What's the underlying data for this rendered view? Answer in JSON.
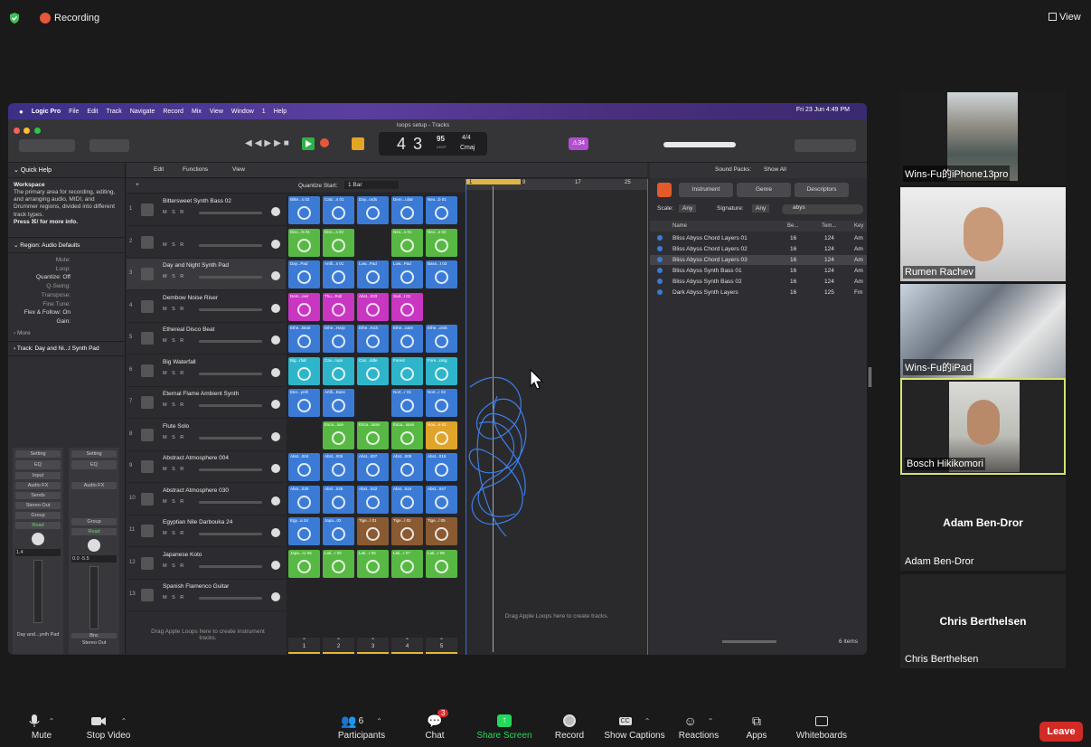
{
  "zoom": {
    "recording_label": "Recording",
    "view_label": "View",
    "toolbar": [
      {
        "label": "Mute",
        "icon": "microphone-icon"
      },
      {
        "label": "Stop Video",
        "icon": "camera-icon"
      },
      {
        "label": "Participants",
        "icon": "participants-icon",
        "count": "6"
      },
      {
        "label": "Chat",
        "icon": "chat-icon",
        "badge": "3"
      },
      {
        "label": "Share Screen",
        "icon": "share-screen-icon"
      },
      {
        "label": "Record",
        "icon": "record-icon"
      },
      {
        "label": "Show Captions",
        "icon": "captions-icon"
      },
      {
        "label": "Reactions",
        "icon": "reactions-icon"
      },
      {
        "label": "Apps",
        "icon": "apps-icon"
      },
      {
        "label": "Whiteboards",
        "icon": "whiteboard-icon"
      }
    ],
    "leave_label": "Leave",
    "participants": [
      {
        "name": "Wins-Fu的iPhone13pro"
      },
      {
        "name": "Rumen Rachev"
      },
      {
        "name": "Wins-Fu的iPad"
      },
      {
        "name": "Bosch Hikikomori"
      },
      {
        "name": "Adam Ben-Dror",
        "big": "Adam Ben-Dror"
      },
      {
        "name": "Chris Berthelsen",
        "big": "Chris Berthelsen"
      }
    ],
    "accent": "#0e72ed",
    "speaker_border": "#d7e46d",
    "share_green": "#23d95c"
  },
  "mac_menu": {
    "app": "Logic Pro",
    "items": [
      "File",
      "Edit",
      "Track",
      "Navigate",
      "Record",
      "Mix",
      "View",
      "Window",
      "1",
      "Help"
    ],
    "clock": "Fri 23 Jun  4:49 PM"
  },
  "logic": {
    "window_title": "loops setup - Tracks",
    "lcd": {
      "bar": "4",
      "beat": "3",
      "tempo": "95",
      "tempo_label": "KEEP",
      "sig": "4/4",
      "key": "Cmaj"
    },
    "badge": "⚠34",
    "quick_help": {
      "title": "Quick Help",
      "heading": "Workspace",
      "body": "The primary area for recording, editing, and arranging audio, MIDI, and Drummer regions, divided into different track types.",
      "more": "Press ⌘/ for more info.",
      "region_title": "Region: Audio Defaults",
      "params": [
        "Mute:",
        "Loop:",
        "Quantize: Off",
        "Q-Swing:",
        "Transpose:",
        "Fine Tune:",
        "Flex & Follow: On",
        "Gain:"
      ],
      "more_label": "More",
      "track_label": "Track:  Day and Ni...t Synth Pad",
      "strip1": {
        "setting": "Setting",
        "eq": "EQ",
        "input": "Input",
        "fx": "Audio FX",
        "sends": "Sends",
        "out": "Stereo Out",
        "group": "Group",
        "read": "Read",
        "vals": "1.4",
        "name": "Day and...ynth Pad"
      },
      "strip2": {
        "setting": "Setting",
        "eq": "EQ",
        "fx": "Audio FX",
        "group": "Group",
        "read": "Read",
        "vals": "0.0  -5.5",
        "bnc": "Bnc",
        "name": "Stereo Out"
      }
    },
    "menus": [
      "Edit",
      "Functions",
      "View"
    ],
    "quantize_label": "Quantize Start:",
    "quantize_value": "1 Bar",
    "tracks": [
      {
        "num": "1",
        "name": "Bittersweet Synth Bass 02"
      },
      {
        "num": "2",
        "name": ""
      },
      {
        "num": "3",
        "name": "Day and Night Synth Pad"
      },
      {
        "num": "4",
        "name": "Dembow Noise Riser"
      },
      {
        "num": "5",
        "name": "Ethereal Disco Beat"
      },
      {
        "num": "6",
        "name": "Big Waterfall"
      },
      {
        "num": "7",
        "name": "Eternal Flame Ambient Synth"
      },
      {
        "num": "8",
        "name": "Flute Solo"
      },
      {
        "num": "9",
        "name": "Abstract Atmosphere 004"
      },
      {
        "num": "10",
        "name": "Abstract Atmosphere 030"
      },
      {
        "num": "11",
        "name": "Egyptian Nile Darbouka 24"
      },
      {
        "num": "12",
        "name": "Japanese Koto"
      },
      {
        "num": "13",
        "name": "Spanish Flamenco Guitar"
      }
    ],
    "drag_hint": "Drag Apple Loops here to create instrument tracks.",
    "drag_hint2": "Drag Apple Loops here to create tracks.",
    "cells": [
      [
        "Bitte...s 02",
        "Catc...s 01",
        "Day...ords",
        "Dem...uitar",
        "Neo...b 01"
      ],
      [
        "Disc...ls 01",
        "Disc...s 02",
        "",
        "Neo...s 01",
        "Neo...s 02"
      ],
      [
        "Day...Pad",
        "Artifi...s 01",
        "Low...Pad",
        "Low...Pad",
        "Bass...t 03"
      ],
      [
        "Dem...iser",
        "Thu...Roll",
        "Abst...033",
        "Sod...t 01",
        ""
      ],
      [
        "Ethe...Beat",
        "Ethe...Harp",
        "Ethe...Kick",
        "Ethe...nare",
        "Ethe...ords"
      ],
      [
        "Big...rfall",
        "Cav...rops",
        "Can...ddle",
        "Forest",
        "Fore...ning"
      ],
      [
        "Eter...ynth",
        "Artifi...Bass",
        "",
        "Nort...r 01",
        "Nort...r 02"
      ],
      [
        "",
        "Esca...lute",
        "Esca...lutes",
        "Esca...lutes",
        "Hou...e 01"
      ],
      [
        "Abst...004",
        "Abst...005",
        "Abst...007",
        "Abst...008",
        "Abst...015"
      ],
      [
        "Abst...030",
        "Abst...038",
        "Abst...042",
        "Abst...044",
        "Abst...047"
      ],
      [
        "Egy...a 24",
        "Japa...02",
        "Tige...l 01",
        "Tige...l 02",
        "Tige...l 05"
      ],
      [
        "Japa...ro 06",
        "Lati...r 05",
        "Lati...r 06",
        "Lati...r 07",
        "Lati...r 08"
      ]
    ],
    "scene_nums": [
      "1",
      "2",
      "3",
      "4",
      "5"
    ],
    "ruler": [
      "1",
      "9",
      "17",
      "25"
    ],
    "loops": {
      "sound_packs_label": "Sound Packs:",
      "sound_packs_value": "Show All",
      "tabs": [
        "Instrument",
        "Genre",
        "Descriptors"
      ],
      "scale_label": "Scale:",
      "scale_value": "Any",
      "sig_label": "Signature:",
      "sig_value": "Any",
      "search": "abys",
      "headers": [
        "Name",
        "Be...",
        "Tem...",
        "Key"
      ],
      "rows": [
        {
          "name": "Bliss Abyss Chord Layers 01",
          "beats": "16",
          "tempo": "124",
          "key": "Am"
        },
        {
          "name": "Bliss Abyss Chord Layers 02",
          "beats": "16",
          "tempo": "124",
          "key": "Am"
        },
        {
          "name": "Bliss Abyss Chord Layers 03",
          "beats": "16",
          "tempo": "124",
          "key": "Am"
        },
        {
          "name": "Bliss Abyss Synth Bass 01",
          "beats": "16",
          "tempo": "124",
          "key": "Am"
        },
        {
          "name": "Bliss Abyss Synth Bass 02",
          "beats": "16",
          "tempo": "124",
          "key": "Am"
        },
        {
          "name": "Dark Abyss Synth Layers",
          "beats": "16",
          "tempo": "125",
          "key": "Fm"
        }
      ],
      "count": "6 items"
    }
  }
}
